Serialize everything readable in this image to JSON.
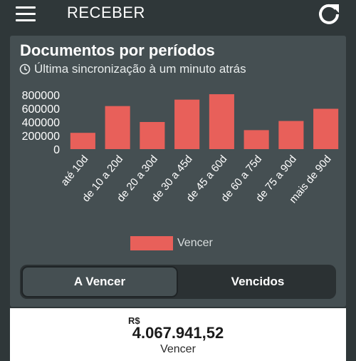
{
  "header": {
    "title": "RECEBER",
    "menu_icon": "hamburger-menu-icon",
    "refresh_icon": "refresh-icon"
  },
  "card": {
    "title": "Documentos por períodos",
    "sync_text": "Última sincronização à um minuto atrás",
    "clock_icon": "clock-icon"
  },
  "chart_data": {
    "type": "bar",
    "categories": [
      "até 10d",
      "de 10 a 20d",
      "de 20 a 30d",
      "de 30 a 45d",
      "de 45 a 60d",
      "de 60 a 75d",
      "de 75 a 90d",
      "mais de 90d"
    ],
    "series": [
      {
        "name": "Vencer",
        "values": [
          240000,
          635000,
          400000,
          730000,
          810000,
          280000,
          415000,
          595000
        ]
      }
    ],
    "y_ticks": [
      "0",
      "200000",
      "400000",
      "600000",
      "800000"
    ],
    "ylim": [
      0,
      800000
    ],
    "bar_color": "#e8605a",
    "legend": "bottom-center",
    "grid": false
  },
  "toggle": {
    "active_label": "A Vencer",
    "inactive_label": "Vencidos"
  },
  "summary": {
    "currency": "R$",
    "amount": "4.067.941,52",
    "label": "Vencer"
  },
  "colors": {
    "background": "#2f3739",
    "card": "#454f52",
    "bar": "#e8605a",
    "toggle_track": "#2b3133"
  }
}
